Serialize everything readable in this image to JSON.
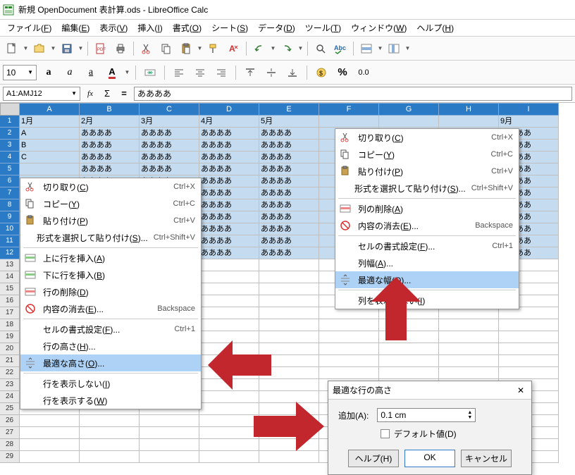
{
  "title": "新規 OpenDocument 表計算.ods - LibreOffice Calc",
  "menubar": [
    "ファイル(F)",
    "編集(E)",
    "表示(V)",
    "挿入(I)",
    "書式(O)",
    "シート(S)",
    "データ(D)",
    "ツール(T)",
    "ウィンドウ(W)",
    "ヘルプ(H)"
  ],
  "fontsize": "10",
  "pct": "0.0",
  "namebox": "A1:AMJ12",
  "sigma": "Σ",
  "eq": "=",
  "formula": "ああああ",
  "cols": [
    "A",
    "B",
    "C",
    "D",
    "E",
    "F",
    "G",
    "H",
    "I"
  ],
  "months": [
    "1月",
    "2月",
    "3月",
    "4月",
    "5月",
    "",
    "",
    "",
    "9月"
  ],
  "firstcol": [
    "",
    "A",
    "B",
    "C",
    "",
    "",
    "",
    "",
    "",
    "",
    "",
    ""
  ],
  "cellval": "ああああ",
  "ctx_row": {
    "items": [
      {
        "ic": "cut",
        "lbl": "切り取り(C)",
        "sc": "Ctrl+X"
      },
      {
        "ic": "copy",
        "lbl": "コピー(Y)",
        "sc": "Ctrl+C"
      },
      {
        "ic": "paste",
        "lbl": "貼り付け(P)",
        "sc": "Ctrl+V"
      },
      {
        "ic": "",
        "lbl": "形式を選択して貼り付け(S)...",
        "sc": "Ctrl+Shift+V"
      }
    ],
    "items2": [
      {
        "ic": "ins",
        "lbl": "上に行を挿入(A)",
        "sc": ""
      },
      {
        "ic": "ins",
        "lbl": "下に行を挿入(B)",
        "sc": ""
      },
      {
        "ic": "del",
        "lbl": "行の削除(D)",
        "sc": ""
      },
      {
        "ic": "clr",
        "lbl": "内容の消去(E)...",
        "sc": "Backspace"
      }
    ],
    "items3": [
      {
        "lbl": "セルの書式設定(F)...",
        "sc": "Ctrl+1"
      },
      {
        "lbl": "行の高さ(H)...",
        "sc": ""
      },
      {
        "lbl": "最適な高さ(O)...",
        "sc": "",
        "hl": true
      }
    ],
    "items4": [
      {
        "lbl": "行を表示しない(I)",
        "sc": ""
      },
      {
        "lbl": "行を表示する(W)",
        "sc": ""
      }
    ]
  },
  "ctx_col": {
    "items": [
      {
        "ic": "cut",
        "lbl": "切り取り(C)",
        "sc": "Ctrl+X"
      },
      {
        "ic": "copy",
        "lbl": "コピー(Y)",
        "sc": "Ctrl+C"
      },
      {
        "ic": "paste",
        "lbl": "貼り付け(P)",
        "sc": "Ctrl+V"
      },
      {
        "ic": "",
        "lbl": "形式を選択して貼り付け(S)...",
        "sc": "Ctrl+Shift+V"
      }
    ],
    "items2": [
      {
        "ic": "del",
        "lbl": "列の削除(A)",
        "sc": ""
      },
      {
        "ic": "clr",
        "lbl": "内容の消去(E)...",
        "sc": "Backspace"
      }
    ],
    "items3": [
      {
        "lbl": "セルの書式設定(F)...",
        "sc": "Ctrl+1"
      },
      {
        "lbl": "列幅(A)...",
        "sc": ""
      },
      {
        "lbl": "最適な幅(O)...",
        "sc": "",
        "hl": true
      }
    ],
    "items4": [
      {
        "lbl": "列を表示しない(I)",
        "sc": ""
      }
    ]
  },
  "dialog": {
    "title": "最適な行の高さ",
    "label": "追加(A):",
    "value": "0.1 cm",
    "check": "デフォルト値(D)",
    "help": "ヘルプ(H)",
    "ok": "OK",
    "cancel": "キャンセル"
  }
}
